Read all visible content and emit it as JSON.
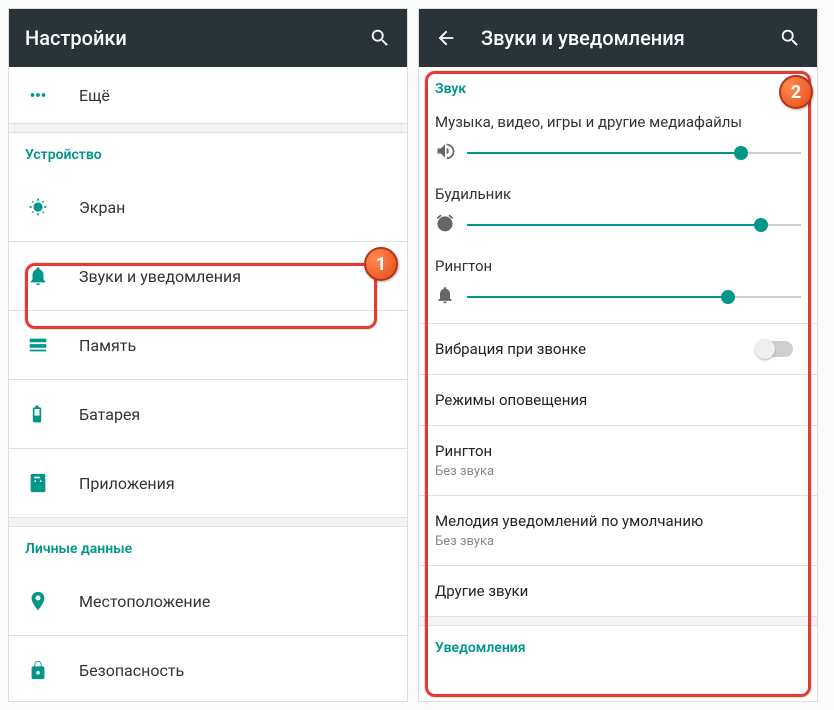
{
  "screen1": {
    "title": "Настройки",
    "items": {
      "more": "Ещё",
      "deviceHeader": "Устройство",
      "display": "Экран",
      "sounds": "Звуки и уведомления",
      "storage": "Память",
      "battery": "Батарея",
      "apps": "Приложения",
      "personalHeader": "Личные данные",
      "location": "Местоположение",
      "security": "Безопасность"
    }
  },
  "screen2": {
    "title": "Звуки и уведомления",
    "soundHeader": "Звук",
    "sliders": {
      "media": {
        "label": "Музыка, видео, игры и другие медиафайлы",
        "value": 82
      },
      "alarm": {
        "label": "Будильник",
        "value": 88
      },
      "ring": {
        "label": "Рингтон",
        "value": 78
      }
    },
    "vibrate": "Вибрация при звонке",
    "modes": "Режимы оповещения",
    "ringtone": {
      "primary": "Рингтон",
      "secondary": "Без звука"
    },
    "notifSound": {
      "primary": "Мелодия уведомлений по умолчанию",
      "secondary": "Без звука"
    },
    "other": "Другие звуки",
    "notifHeader": "Уведомления"
  },
  "badges": {
    "one": "1",
    "two": "2"
  }
}
